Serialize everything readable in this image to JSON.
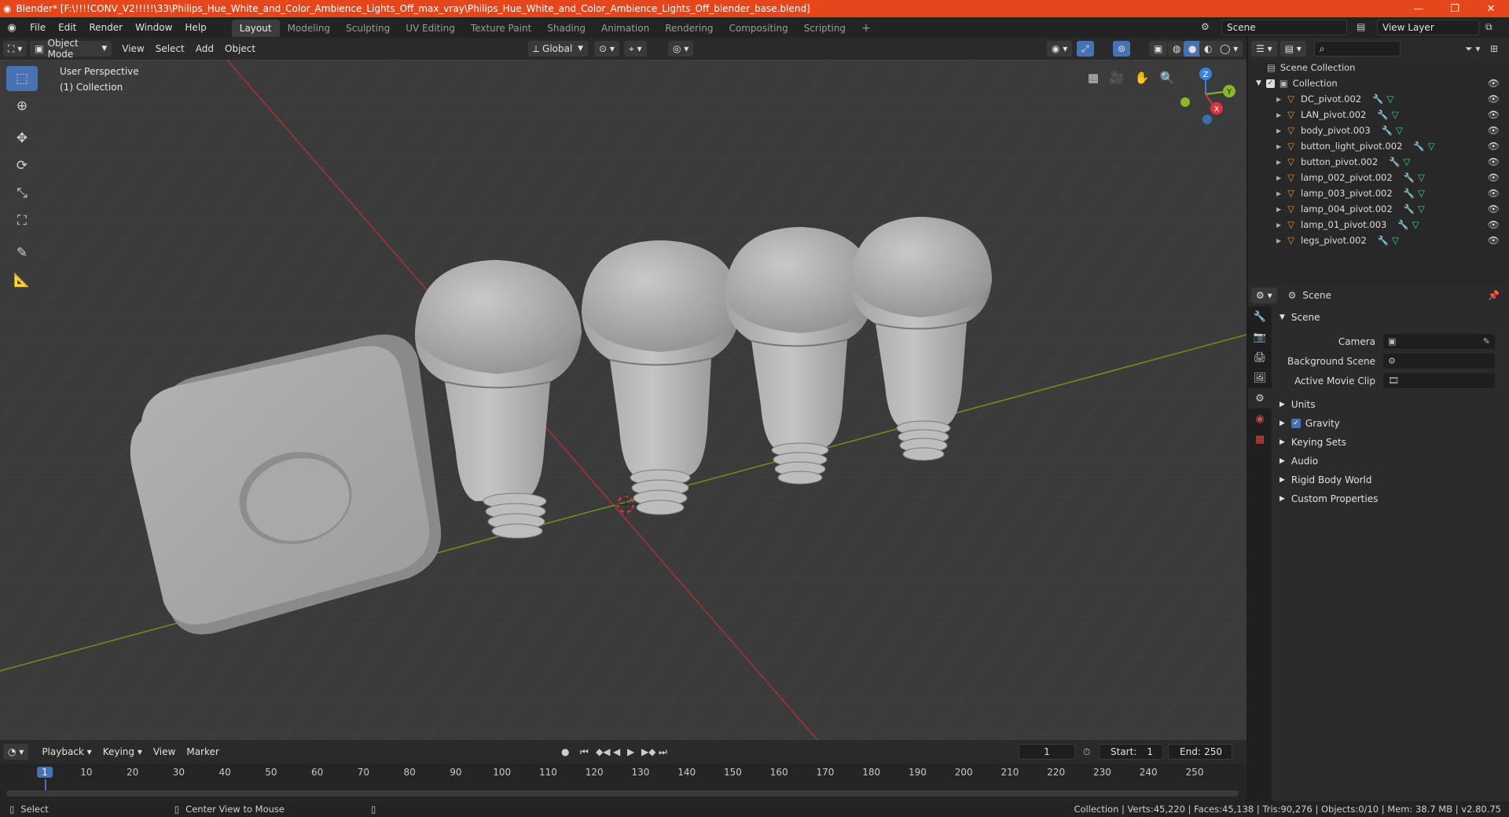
{
  "window": {
    "title": "Blender* [F:\\!!!!CONV_V2!!!!!\\33\\Philips_Hue_White_and_Color_Ambience_Lights_Off_max_vray\\Philips_Hue_White_and_Color_Ambience_Lights_Off_blender_base.blend]",
    "minimize": "—",
    "maximize": "❐",
    "close": "✕"
  },
  "menu": [
    "File",
    "Edit",
    "Render",
    "Window",
    "Help"
  ],
  "workspaces": [
    "Layout",
    "Modeling",
    "Sculpting",
    "UV Editing",
    "Texture Paint",
    "Shading",
    "Animation",
    "Rendering",
    "Compositing",
    "Scripting"
  ],
  "active_workspace": "Layout",
  "scene_selector": {
    "value": "Scene"
  },
  "view_layer_selector": {
    "value": "View Layer"
  },
  "viewport_header": {
    "mode": "Object Mode",
    "menus": [
      "View",
      "Select",
      "Add",
      "Object"
    ],
    "orientation": "Global"
  },
  "viewport": {
    "perspective_label": "User Perspective",
    "collection_label": "(1) Collection",
    "gizmo_axes": {
      "x": "X",
      "y": "Y",
      "z": "Z"
    },
    "colors": {
      "background": "#3b3b3b",
      "grid": "#454545",
      "x_axis": "#a3313a",
      "y_axis": "#6e8c1f",
      "accent": "#4772b3"
    }
  },
  "outliner": {
    "root": "Scene Collection",
    "collection": "Collection",
    "items": [
      "DC_pivot.002",
      "LAN_pivot.002",
      "body_pivot.003",
      "button_light_pivot.002",
      "button_pivot.002",
      "lamp_002_pivot.002",
      "lamp_003_pivot.002",
      "lamp_004_pivot.002",
      "lamp_01_pivot.003",
      "legs_pivot.002"
    ]
  },
  "properties": {
    "header": "Scene",
    "section": "Scene",
    "camera_label": "Camera",
    "background_scene_label": "Background Scene",
    "active_movie_clip_label": "Active Movie Clip",
    "panels": [
      "Units",
      "Gravity",
      "Keying Sets",
      "Audio",
      "Rigid Body World",
      "Custom Properties"
    ],
    "gravity_checked": true
  },
  "timeline": {
    "menus": [
      "Playback",
      "Keying",
      "View",
      "Marker"
    ],
    "current_frame": "1",
    "start_label": "Start:",
    "start_value": "1",
    "end_label": "End:",
    "end_value": "250",
    "ticks": [
      "1",
      "10",
      "20",
      "30",
      "40",
      "50",
      "60",
      "70",
      "80",
      "90",
      "100",
      "110",
      "120",
      "130",
      "140",
      "150",
      "160",
      "170",
      "180",
      "190",
      "200",
      "210",
      "220",
      "230",
      "240",
      "250"
    ]
  },
  "statusbar": {
    "left_action": "Select",
    "middle_action": "Center View to Mouse",
    "stats": "Collection | Verts:45,220 | Faces:45,138 | Tris:90,276 | Objects:0/10 | Mem: 38.7 MB | v2.80.75"
  }
}
